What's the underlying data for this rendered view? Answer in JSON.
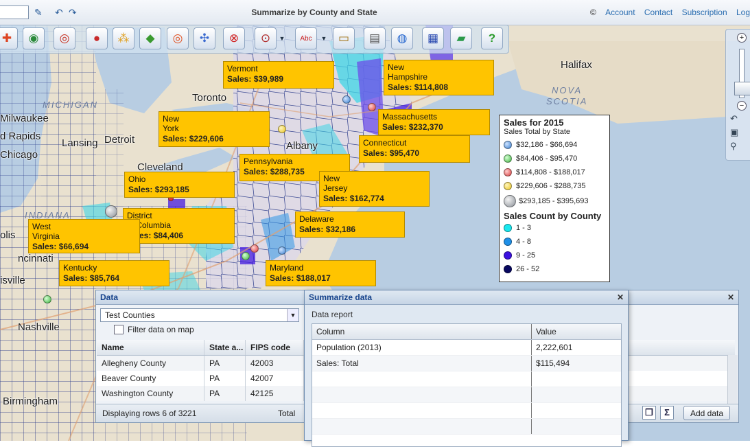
{
  "header": {
    "title": "Summarize by County and State",
    "copyright": "©",
    "links": [
      "Account",
      "Contact",
      "Subscription",
      "Log"
    ]
  },
  "toolbar_icons": [
    "puzzle-icon",
    "globe-add-icon",
    "target-icon",
    "dots-icon",
    "balls-icon",
    "leaf-icon",
    "rings-icon",
    "puzzle-pieces-icon",
    "stop-icon",
    "radius-icon",
    "textbox-icon",
    "ruler-icon",
    "printer-icon",
    "globe-save-icon",
    "calendar-icon",
    "car-icon",
    "help-icon"
  ],
  "map": {
    "cities": [
      {
        "name": "Toronto"
      },
      {
        "name": "Halifax"
      },
      {
        "name": "Milwaukee"
      },
      {
        "name": "d Rapids"
      },
      {
        "name": "Lansing"
      },
      {
        "name": "Detroit"
      },
      {
        "name": "Chicago"
      },
      {
        "name": "Cleveland"
      },
      {
        "name": "Albany"
      },
      {
        "name": "ncinnati"
      },
      {
        "name": "isville"
      },
      {
        "name": "Nashville"
      },
      {
        "name": "Birmingham"
      },
      {
        "name": "olis"
      }
    ],
    "regions": [
      {
        "name": "MICHIGAN"
      },
      {
        "name": "NOVA"
      },
      {
        "name": "SCOTIA"
      },
      {
        "name": "INDIANA"
      }
    ]
  },
  "callouts": [
    {
      "name": "Vermont",
      "sales": "$39,989"
    },
    {
      "name": "New\nHampshire",
      "sales": "$114,808"
    },
    {
      "name": "New\nYork",
      "sales": "$229,606"
    },
    {
      "name": "Massachusetts",
      "sales": "$232,370"
    },
    {
      "name": "Connecticut",
      "sales": "$95,470"
    },
    {
      "name": "Pennsylvania",
      "sales": "$288,735"
    },
    {
      "name": "Ohio",
      "sales": "$293,185"
    },
    {
      "name": "New\nJersey",
      "sales": "$162,774"
    },
    {
      "name": "District\nof Columbia",
      "sales": "$84,406"
    },
    {
      "name": "West\nVirginia",
      "sales": "$66,694"
    },
    {
      "name": "Delaware",
      "sales": "$32,186"
    },
    {
      "name": "Kentucky",
      "sales": "$85,764"
    },
    {
      "name": "Maryland",
      "sales": "$188,017"
    }
  ],
  "sales_prefix": "Sales:",
  "legend": {
    "title": "Sales for 2015",
    "subtitle": "Sales Total by State",
    "sales_ranges": [
      {
        "label": "$32,186 - $66,694",
        "color": "#3a7fd0"
      },
      {
        "label": "$84,406 - $95,470",
        "color": "#3fb43f"
      },
      {
        "label": "$114,808 - $188,017",
        "color": "#d83a3a"
      },
      {
        "label": "$229,606 - $288,735",
        "color": "#e8c21c"
      },
      {
        "label": "$293,185 - $395,693",
        "color": "#9aa0a8"
      }
    ],
    "count_title": "Sales Count by County",
    "count_ranges": [
      {
        "label": "1 - 3",
        "color": "#19e8ef"
      },
      {
        "label": "4 - 8",
        "color": "#1e90e8"
      },
      {
        "label": "9 - 25",
        "color": "#3b10e0"
      },
      {
        "label": "26 - 52",
        "color": "#080860"
      }
    ]
  },
  "data_panel": {
    "title": "Data",
    "layer": "Test Counties",
    "filter_label": "Filter data on map",
    "columns": [
      "Name",
      "State a...",
      "FIPS code"
    ],
    "rows": [
      [
        "Allegheny County",
        "PA",
        "42003"
      ],
      [
        "Beaver County",
        "PA",
        "42007"
      ],
      [
        "Washington County",
        "PA",
        "42125"
      ]
    ],
    "displaying": "Displaying rows 6 of 3221",
    "total_label": "Total",
    "add_data": "Add data"
  },
  "summarize": {
    "title": "Summarize data",
    "subtitle": "Data report",
    "columns": [
      "Column",
      "Value"
    ],
    "rows": [
      [
        "Population (2013)",
        "2,222,601"
      ],
      [
        "Sales: Total",
        "$115,494"
      ]
    ]
  }
}
